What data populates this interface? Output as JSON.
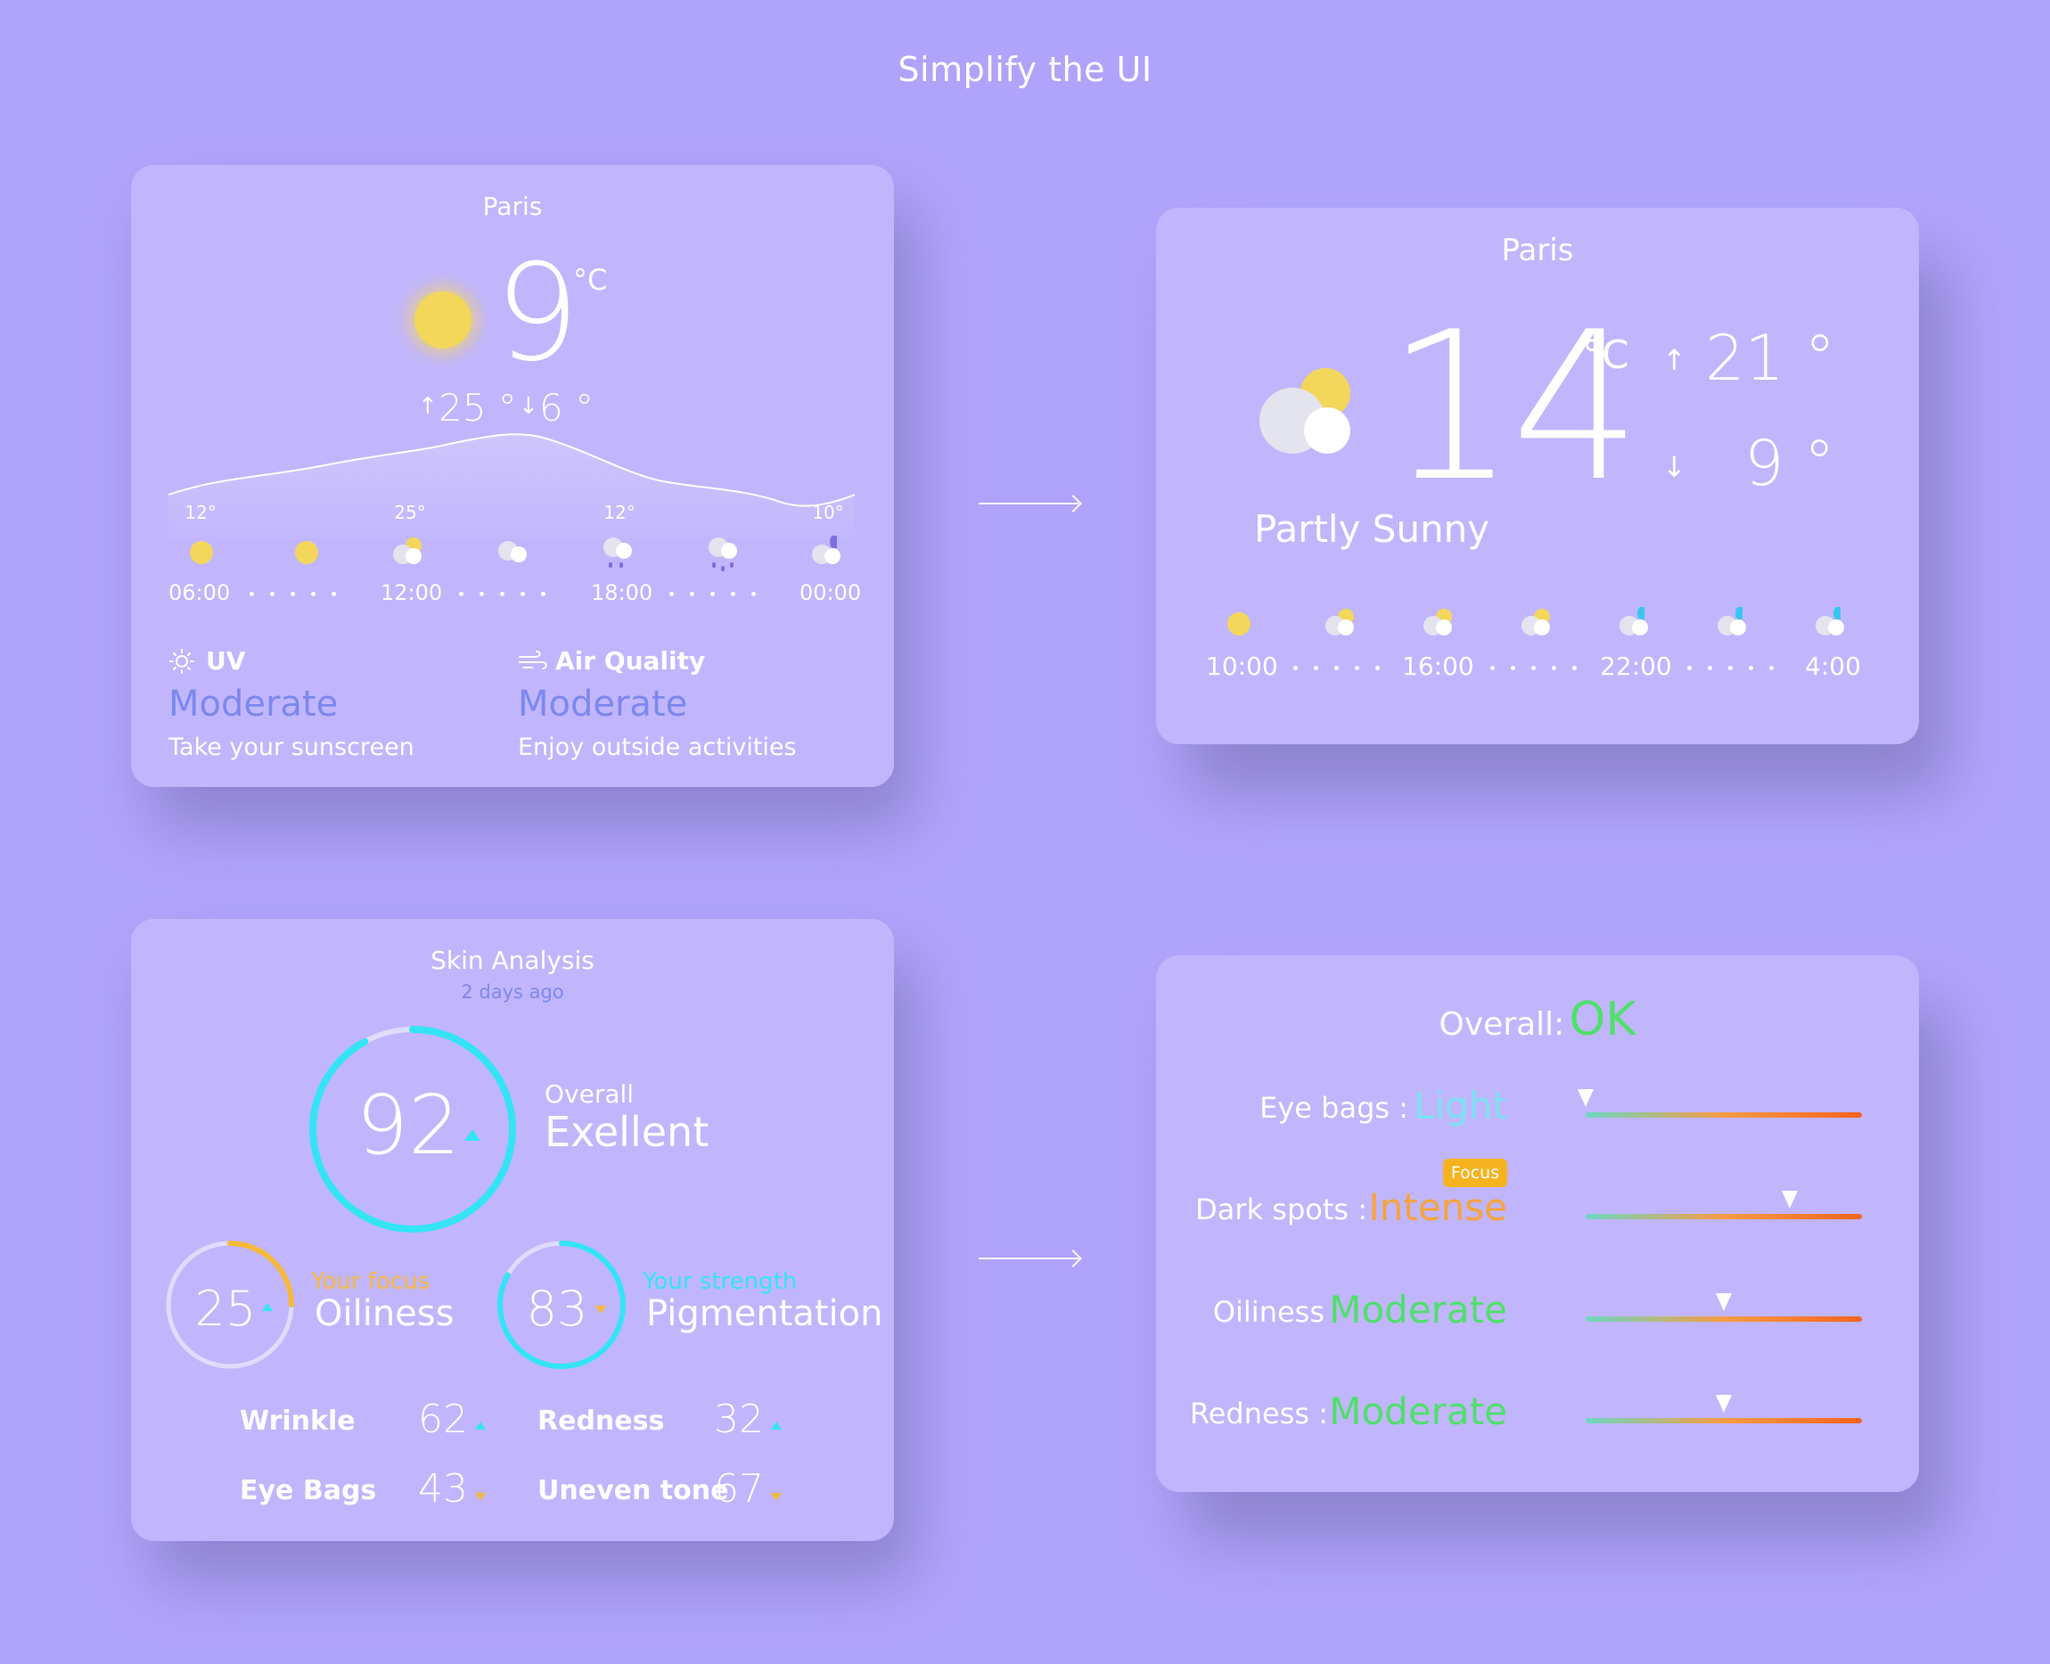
{
  "page": {
    "title": "Simplify the UI"
  },
  "weather_before": {
    "city": "Paris",
    "temp": "9",
    "unit": "°C",
    "high": "25 °",
    "low": "6 °",
    "curve_labels": [
      "12°",
      "25°",
      "12°",
      "10°"
    ],
    "times": [
      "06:00",
      "12:00",
      "18:00",
      "00:00"
    ],
    "uv": {
      "label": "UV",
      "value": "Moderate",
      "note": "Take your sunscreen"
    },
    "air": {
      "label": "Air Quality",
      "value": "Moderate",
      "note": "Enjoy outside activities"
    }
  },
  "weather_after": {
    "city": "Paris",
    "temp": "14",
    "unit": "°C",
    "high": "21 °",
    "low": "9 °",
    "condition": "Partly Sunny",
    "times": [
      "10:00",
      "16:00",
      "22:00",
      "4:00"
    ]
  },
  "skin_before": {
    "title": "Skin Analysis",
    "subtitle": "2 days ago",
    "overall": {
      "score": "92",
      "score_value": 92,
      "label": "Overall",
      "value": "Exellent"
    },
    "focus": {
      "score": "25",
      "score_value": 25,
      "tag": "Your focus",
      "name": "Oiliness"
    },
    "strength": {
      "score": "83",
      "score_value": 83,
      "tag": "Your strength",
      "name": "Pigmentation"
    },
    "metrics": [
      {
        "name": "Wrinkle",
        "value": "62",
        "trend": "up"
      },
      {
        "name": "Redness",
        "value": "32",
        "trend": "up"
      },
      {
        "name": "Eye Bags",
        "value": "43",
        "trend": "down"
      },
      {
        "name": "Uneven tone",
        "value": "67",
        "trend": "down"
      }
    ]
  },
  "skin_after": {
    "overall_label": "Overall:",
    "overall_value": "OK",
    "focus_badge": "Focus",
    "rows": [
      {
        "label": "Eye bags :",
        "value": "Light",
        "level": 0.0,
        "color": "#7fe0f0"
      },
      {
        "label": "Dark spots :",
        "value": "Intense",
        "level": 0.74,
        "color": "#f6a33a"
      },
      {
        "label": "Oiliness",
        "value": "Moderate",
        "level": 0.5,
        "color": "#4fe06a"
      },
      {
        "label": "Redness :",
        "value": "Moderate",
        "level": 0.5,
        "color": "#4fe06a"
      }
    ]
  },
  "colors": {
    "background": "#b0a3fb",
    "card": "#c1b6fd",
    "accent_blue": "#7c88ef",
    "ring": "#34e4f5",
    "focus": "#f6b93b"
  }
}
